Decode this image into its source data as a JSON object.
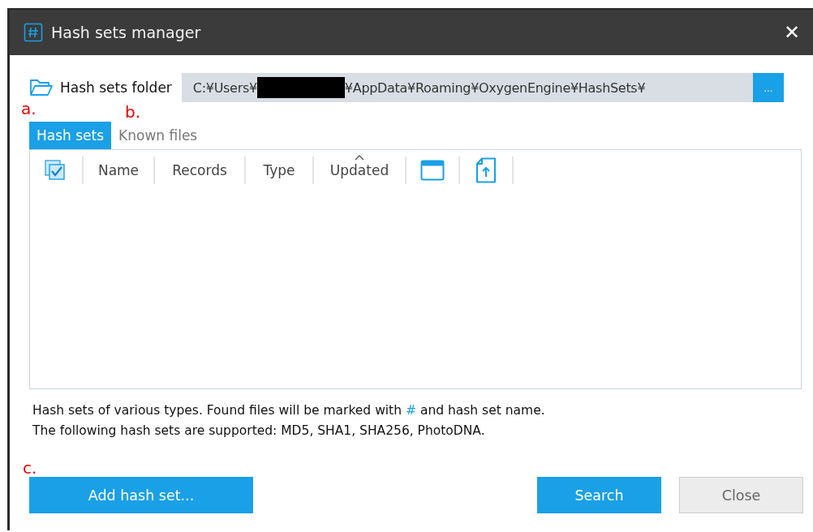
{
  "window": {
    "title": "Hash sets manager",
    "close": "✕"
  },
  "folder": {
    "label": "Hash sets folder",
    "path_start": "C:¥Users¥",
    "path_end": "¥AppData¥Roaming¥OxygenEngine¥HashSets¥",
    "redacted": true,
    "browse": "..."
  },
  "annotations": [
    "a.",
    "b.",
    "c."
  ],
  "tabs": [
    {
      "label": "Hash sets",
      "selected": true
    },
    {
      "label": "Known files",
      "selected": false
    }
  ],
  "table": {
    "columns": [
      {
        "kind": "checkbox",
        "checked": true
      },
      {
        "kind": "text",
        "label": "Name",
        "sorted": false
      },
      {
        "kind": "text",
        "label": "Records",
        "sorted": false
      },
      {
        "kind": "text",
        "label": "Type",
        "sorted": false
      },
      {
        "kind": "text",
        "label": "Updated",
        "sorted": true
      },
      {
        "kind": "window"
      },
      {
        "kind": "upload"
      },
      {
        "kind": "empty"
      }
    ]
  },
  "description": [
    [
      {
        "text": "Hash sets of various types. Found files will be marked with ",
        "accent": false
      },
      {
        "text": "#",
        "accent": true
      },
      {
        "text": " and hash set name.",
        "accent": false
      }
    ],
    [
      {
        "text": "The following hash sets are supported: MD5, SHA1, SHA256, PhotoDNA.",
        "accent": false
      }
    ]
  ],
  "buttons": {
    "add": {
      "label": "Add hash set...",
      "primary": true
    },
    "search": {
      "label": "Search",
      "primary": true
    },
    "close": {
      "label": "Close",
      "primary": false
    }
  }
}
